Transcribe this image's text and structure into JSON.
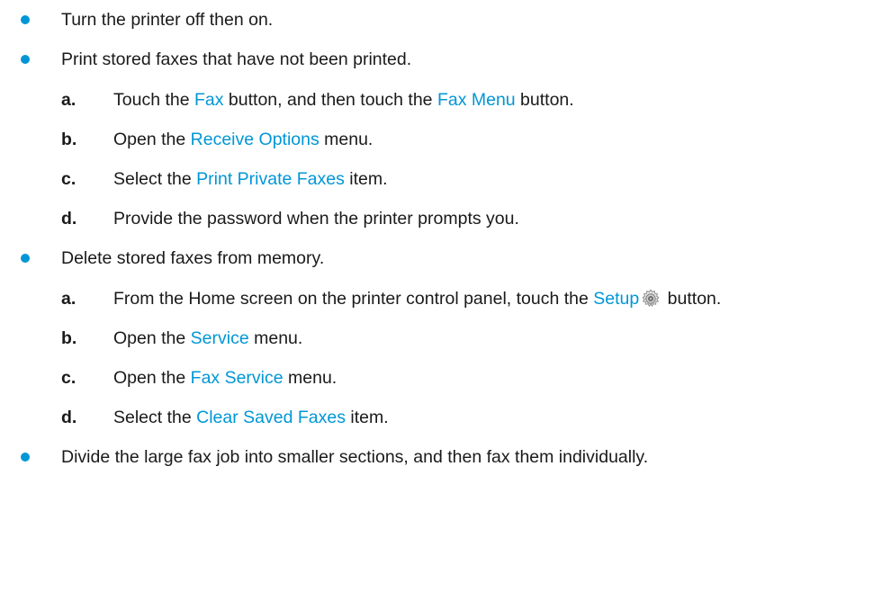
{
  "items": [
    {
      "text": "Turn the printer off then on."
    },
    {
      "text": "Print stored faxes that have not been printed.",
      "steps": [
        {
          "letter": "a.",
          "pre": "Touch the ",
          "ui1": "Fax",
          "mid": " button, and then touch the ",
          "ui2": "Fax Menu",
          "post": " button."
        },
        {
          "letter": "b.",
          "pre": "Open the ",
          "ui1": "Receive Options",
          "post": " menu."
        },
        {
          "letter": "c.",
          "pre": "Select the ",
          "ui1": "Print Private Faxes",
          "post": " item."
        },
        {
          "letter": "d.",
          "text": "Provide the password when the printer prompts you."
        }
      ]
    },
    {
      "text": "Delete stored faxes from memory.",
      "steps": [
        {
          "letter": "a.",
          "pre": "From the Home screen on the printer control panel, touch the ",
          "ui1": "Setup",
          "icon": "gear-icon",
          "post": " button."
        },
        {
          "letter": "b.",
          "pre": "Open the ",
          "ui1": "Service",
          "post": " menu."
        },
        {
          "letter": "c.",
          "pre": "Open the ",
          "ui1": "Fax Service",
          "post": " menu."
        },
        {
          "letter": "d.",
          "pre": "Select the ",
          "ui1": "Clear Saved Faxes",
          "post": " item."
        }
      ]
    },
    {
      "text": "Divide the large fax job into smaller sections, and then fax them individually."
    }
  ],
  "colors": {
    "accent": "#0096d6",
    "text": "#1a1a1a"
  }
}
